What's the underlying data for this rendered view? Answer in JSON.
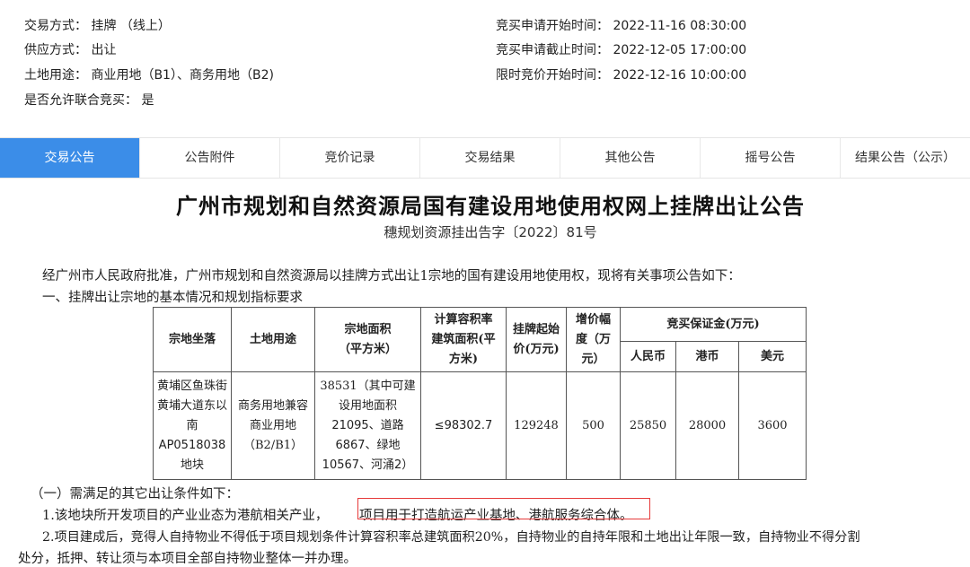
{
  "info": {
    "trade_method": "交易方式： 挂牌 （线上）",
    "supply_method": "供应方式： 出让",
    "land_use": "土地用途： 商业用地（B1）、商务用地（B2)",
    "joint_bid": "是否允许联合竞买： 是",
    "apply_start": "竞买申请开始时间： 2022-11-16 08:30:00",
    "apply_end": "竞买申请截止时间： 2022-12-05 17:00:00",
    "bid_start": "限时竞价开始时间： 2022-12-16 10:00:00"
  },
  "tabs": [
    "交易公告",
    "公告附件",
    "竞价记录",
    "交易结果",
    "其他公告",
    "摇号公告",
    "结果公告（公示）"
  ],
  "notice": {
    "title": "广州市规划和自然资源局国有建设用地使用权网上挂牌出让公告",
    "doc_no": "穗规划资源挂出告字〔2022〕81号",
    "intro": "经广州市人民政府批准，广州市规划和自然资源局以挂牌方式出让1宗地的国有建设用地使用权，现将有关事项公告如下：",
    "section1": "一、挂牌出让宗地的基本情况和规划指标要求",
    "table": {
      "h_location": "宗地坐落",
      "h_use": "土地用途",
      "h_area_1": "宗地面积",
      "h_area_2": "（平方米）",
      "h_far_1": "计算容积率",
      "h_far_2": "建筑面积(平",
      "h_far_3": "方米)",
      "h_price_1": "挂牌起始",
      "h_price_2": "价(万元)",
      "h_inc_1": "增价幅",
      "h_inc_2": "度（万",
      "h_inc_3": "元）",
      "h_deposit": "竞买保证金(万元)",
      "h_rmb": "人民币",
      "h_hkd": "港币",
      "h_usd": "美元",
      "loc_1": "黄埔区鱼珠街",
      "loc_2": "黄埔大道东以",
      "loc_3": "南",
      "loc_4": "AP0518038",
      "loc_5": "地块",
      "use_1": "商务用地兼容",
      "use_2": "商业用地",
      "use_3": "（B2/B1）",
      "area_1": "38531（其中可建",
      "area_2": "设用地面积",
      "area_3": "21095、道路",
      "area_4": "6867、绿地",
      "area_5": "10567、河涌2）",
      "far": "≤98302.7",
      "price": "129248",
      "increment": "500",
      "rmb": "25850",
      "hkd": "28000",
      "usd": "3600"
    },
    "cond_head": "（一）需满足的其它出让条件如下：",
    "cond1_a": "1.该地块所开发项目的产业业态为港航相关产业，",
    "cond1_b": "项目用于打造航运产业基地、港航服务综合体。",
    "cond2_a": "2.项目建成后，竞得人自持物业不得低于项目规划条件计算容积率总建筑面积20%，自持物业的自持年限和土地出让年限一致，自持物业不得分割",
    "cond2_b": "处分，抵押、转让须与本项目全部自持物业整体一并办理。"
  },
  "colors": {
    "active_tab": "#3b8de8",
    "highlight_box": "#e63a3a"
  }
}
